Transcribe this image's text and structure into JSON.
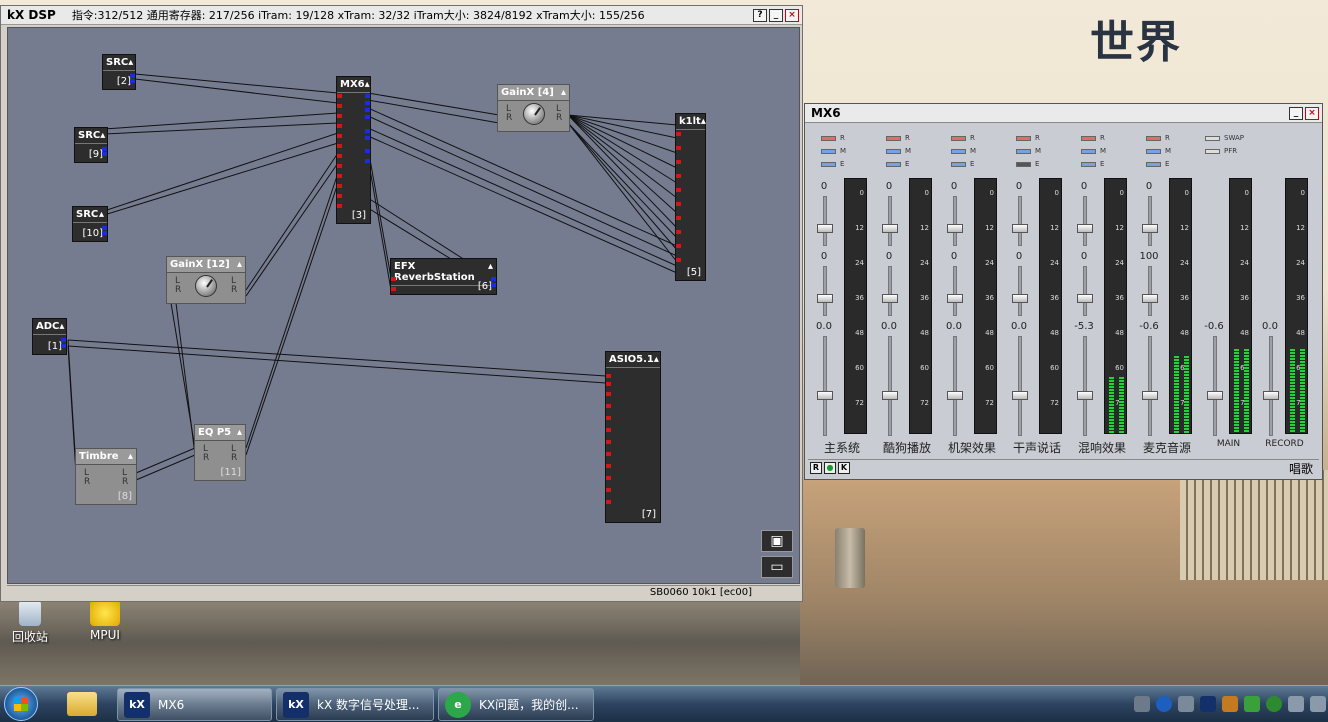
{
  "dsp_window": {
    "title": "kX DSP",
    "stats": "指令:312/512 通用寄存器: 217/256 iTram: 19/128 xTram: 32/32 iTram大小: 3824/8192 xTram大小: 155/256",
    "status": "SB0060 10k1 [ec00]",
    "buttons": {
      "help": "?",
      "minimize": "_",
      "close": "×"
    },
    "blocks": {
      "src2": {
        "name": "SRC",
        "idx": "[2]"
      },
      "src9": {
        "name": "SRC",
        "idx": "[9]"
      },
      "src10": {
        "name": "SRC",
        "idx": "[10]"
      },
      "mx6": {
        "name": "MX6",
        "idx": "[3]"
      },
      "gainx4": {
        "name": "GainX [4]"
      },
      "k1lt": {
        "name": "k1lt",
        "idx": "[5]"
      },
      "gainx12": {
        "name": "GainX [12]"
      },
      "reverb": {
        "name": "EFX ReverbStation",
        "idx": "[6]"
      },
      "adc": {
        "name": "ADC",
        "idx": "[1]"
      },
      "asio": {
        "name": "ASIO5.1",
        "idx": "[7]"
      },
      "timbre": {
        "name": "Timbre",
        "idx": "[8]"
      },
      "eqp5": {
        "name": "EQ P5",
        "idx": "[11]"
      }
    },
    "lr": {
      "l": "L",
      "r": "R"
    }
  },
  "mx6_window": {
    "title": "MX6",
    "toggles": {
      "r": "R",
      "m": "M",
      "e": "E"
    },
    "global_toggles": [
      "SWAP",
      "PFR"
    ],
    "meter_ticks": [
      "0",
      "12",
      "24",
      "36",
      "48",
      "60",
      "72"
    ],
    "channels": [
      {
        "label": "主系统",
        "v1": "0",
        "v2": "0",
        "v3": "0.0",
        "level": 0.0
      },
      {
        "label": "酷狗播放",
        "v1": "0",
        "v2": "0",
        "v3": "0.0",
        "level": 0.0
      },
      {
        "label": "机架效果",
        "v1": "0",
        "v2": "0",
        "v3": "0.0",
        "level": 0.0
      },
      {
        "label": "干声说话",
        "v1": "0",
        "v2": "0",
        "v3": "0.0",
        "level": 0.0
      },
      {
        "label": "混响效果",
        "v1": "0",
        "v2": "0",
        "v3": "-5.3",
        "level": 0.22
      },
      {
        "label": "麦克音源",
        "v1": "0",
        "v2": "100",
        "v3": "-0.6",
        "level": 0.3
      }
    ],
    "outputs": [
      {
        "label": "MAIN",
        "value": "-0.6",
        "level": 0.33
      },
      {
        "label": "RECORD",
        "value": "0.0",
        "level": 0.33
      }
    ],
    "footer_buttons": [
      "R",
      "●",
      "K"
    ],
    "footer_right": "唱歌",
    "buttons": {
      "minimize": "_",
      "close": "×"
    }
  },
  "desktop": {
    "icons": [
      {
        "label": "回收站"
      },
      {
        "label": "MPUI"
      }
    ],
    "wall_text": "世界"
  },
  "taskbar": {
    "tasks": [
      {
        "label": "MX6",
        "icon": "kX"
      },
      {
        "label": "kX 数字信号处理...",
        "icon": "kX"
      },
      {
        "label": "KX问题，我的创...",
        "icon": "e"
      }
    ]
  }
}
